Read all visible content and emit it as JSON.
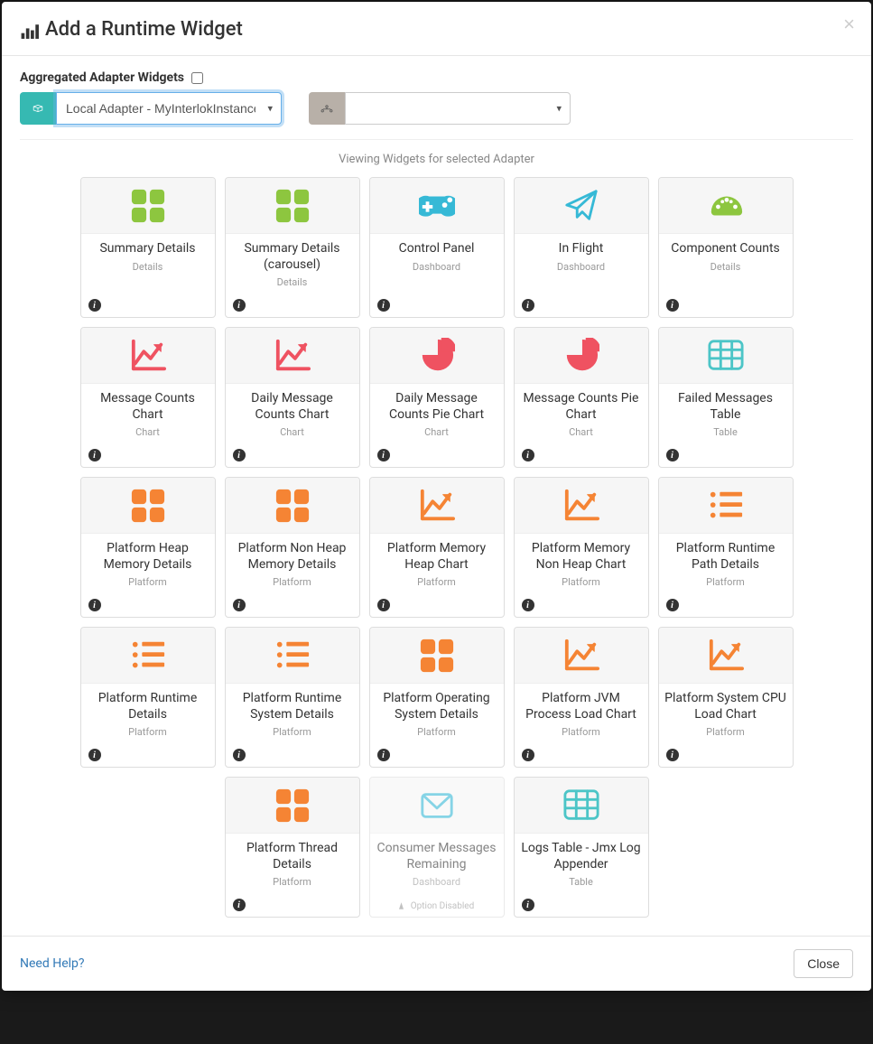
{
  "header": {
    "title": "Add a Runtime Widget"
  },
  "agg": {
    "label": "Aggregated Adapter Widgets",
    "checked": false
  },
  "selector1": {
    "value": "Local Adapter - MyInterlokInstance"
  },
  "selector2": {
    "value": ""
  },
  "viewing_text": "Viewing Widgets for selected Adapter",
  "widgets": [
    {
      "title": "Summary Details",
      "category": "Details",
      "icon": "grid-green",
      "disabled": false
    },
    {
      "title": "Summary Details (carousel)",
      "category": "Details",
      "icon": "grid-green",
      "disabled": false
    },
    {
      "title": "Control Panel",
      "category": "Dashboard",
      "icon": "gamepad-teal",
      "disabled": false
    },
    {
      "title": "In Flight",
      "category": "Dashboard",
      "icon": "paperplane-teal",
      "disabled": false
    },
    {
      "title": "Component Counts",
      "category": "Details",
      "icon": "gauge-green",
      "disabled": false
    },
    {
      "title": "Message Counts Chart",
      "category": "Chart",
      "icon": "linechart-red",
      "disabled": false
    },
    {
      "title": "Daily Message Counts Chart",
      "category": "Chart",
      "icon": "linechart-red",
      "disabled": false
    },
    {
      "title": "Daily Message Counts Pie Chart",
      "category": "Chart",
      "icon": "piechart-red",
      "disabled": false
    },
    {
      "title": "Message Counts Pie Chart",
      "category": "Chart",
      "icon": "piechart-red",
      "disabled": false
    },
    {
      "title": "Failed Messages Table",
      "category": "Table",
      "icon": "table-teal",
      "disabled": false
    },
    {
      "title": "Platform Heap Memory Details",
      "category": "Platform",
      "icon": "grid-orange",
      "disabled": false
    },
    {
      "title": "Platform Non Heap Memory Details",
      "category": "Platform",
      "icon": "grid-orange",
      "disabled": false
    },
    {
      "title": "Platform Memory Heap Chart",
      "category": "Platform",
      "icon": "linechart-orange",
      "disabled": false
    },
    {
      "title": "Platform Memory Non Heap Chart",
      "category": "Platform",
      "icon": "linechart-orange",
      "disabled": false
    },
    {
      "title": "Platform Runtime Path Details",
      "category": "Platform",
      "icon": "list-orange",
      "disabled": false
    },
    {
      "title": "Platform Runtime Details",
      "category": "Platform",
      "icon": "list-orange",
      "disabled": false
    },
    {
      "title": "Platform Runtime System Details",
      "category": "Platform",
      "icon": "list-orange",
      "disabled": false
    },
    {
      "title": "Platform Operating System Details",
      "category": "Platform",
      "icon": "grid-orange",
      "disabled": false
    },
    {
      "title": "Platform JVM Process Load Chart",
      "category": "Platform",
      "icon": "linechart-orange",
      "disabled": false
    },
    {
      "title": "Platform System CPU Load Chart",
      "category": "Platform",
      "icon": "linechart-orange",
      "disabled": false
    },
    {
      "title": "Platform Thread Details",
      "category": "Platform",
      "icon": "grid-orange",
      "disabled": false
    },
    {
      "title": "Consumer Messages Remaining",
      "category": "Dashboard",
      "icon": "envelope-teal",
      "disabled": true,
      "disabled_text": "Option Disabled"
    },
    {
      "title": "Logs Table - Jmx Log Appender",
      "category": "Table",
      "icon": "table-teal",
      "disabled": false
    }
  ],
  "colors": {
    "green": "#8dc63f",
    "teal": "#36b9d6",
    "red": "#ef5261",
    "orange": "#f58434",
    "teal2": "#4cc5c7"
  },
  "footer": {
    "help": "Need Help?",
    "close": "Close"
  }
}
